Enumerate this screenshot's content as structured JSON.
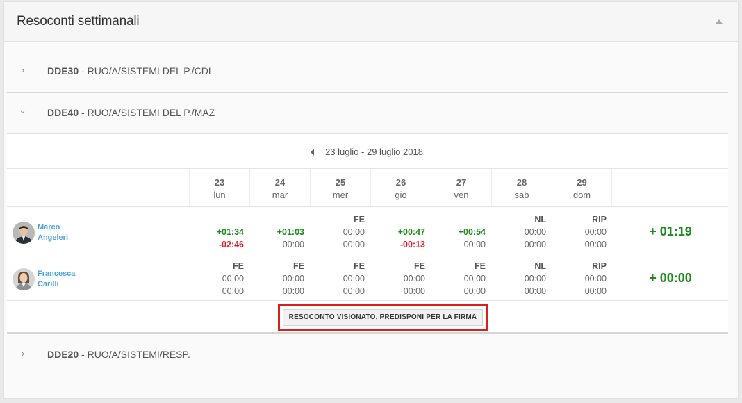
{
  "panel": {
    "title": "Resoconti settimanali"
  },
  "groups": [
    {
      "code": "DDE30",
      "desc": " - RUO/A/SISTEMI DEL P./CDL",
      "expanded": false
    },
    {
      "code": "DDE40",
      "desc": " - RUO/A/SISTEMI DEL P./MAZ",
      "expanded": true
    },
    {
      "code": "DDE20",
      "desc": " - RUO/A/SISTEMI/RESP.",
      "expanded": false
    }
  ],
  "week": {
    "label": "23 luglio - 29 luglio 2018"
  },
  "days": [
    {
      "num": "23",
      "name": "lun"
    },
    {
      "num": "24",
      "name": "mar"
    },
    {
      "num": "25",
      "name": "mer"
    },
    {
      "num": "26",
      "name": "gio"
    },
    {
      "num": "27",
      "name": "ven"
    },
    {
      "num": "28",
      "name": "sab"
    },
    {
      "num": "29",
      "name": "dom"
    }
  ],
  "people": [
    {
      "first": "Marco",
      "last": "Angeleri",
      "total": "+ 01:19",
      "cells": [
        {
          "tag": "",
          "top": "+01:34",
          "bottom": "-02:46"
        },
        {
          "tag": "",
          "top": "+01:03",
          "bottom": "00:00"
        },
        {
          "tag": "FE",
          "top": "00:00",
          "bottom": "00:00"
        },
        {
          "tag": "",
          "top": "+00:47",
          "bottom": "-00:13"
        },
        {
          "tag": "",
          "top": "+00:54",
          "bottom": "00:00"
        },
        {
          "tag": "NL",
          "top": "00:00",
          "bottom": "00:00"
        },
        {
          "tag": "RIP",
          "top": "00:00",
          "bottom": "00:00"
        }
      ]
    },
    {
      "first": "Francesca",
      "last": "Carilli",
      "total": "+ 00:00",
      "cells": [
        {
          "tag": "FE",
          "top": "00:00",
          "bottom": "00:00"
        },
        {
          "tag": "FE",
          "top": "00:00",
          "bottom": "00:00"
        },
        {
          "tag": "FE",
          "top": "00:00",
          "bottom": "00:00"
        },
        {
          "tag": "FE",
          "top": "00:00",
          "bottom": "00:00"
        },
        {
          "tag": "FE",
          "top": "00:00",
          "bottom": "00:00"
        },
        {
          "tag": "NL",
          "top": "00:00",
          "bottom": "00:00"
        },
        {
          "tag": "RIP",
          "top": "00:00",
          "bottom": "00:00"
        }
      ]
    }
  ],
  "action": {
    "label": "RESOCONTO VISIONATO, PREDISPONI PER LA FIRMA"
  },
  "colors": {
    "positive": "#1f8a1f",
    "negative": "#e01b24",
    "link": "#4aa3df",
    "highlight": "#d9201c"
  },
  "icons": {
    "collapse": "caret-up-icon",
    "expand": "chevron-right-icon",
    "collapse_group": "chevron-down-icon",
    "prev_week": "caret-left-icon"
  }
}
